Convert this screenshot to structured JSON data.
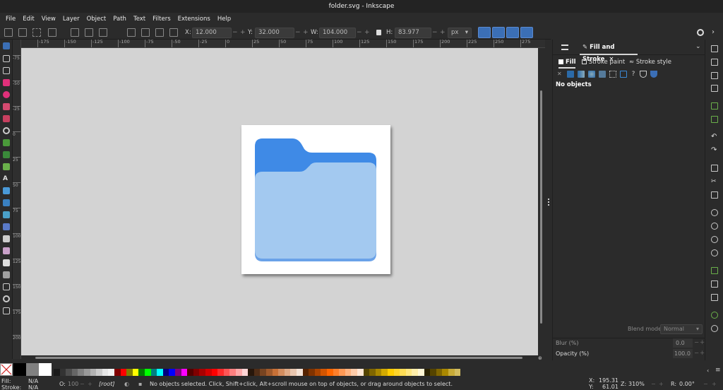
{
  "window": {
    "title": "folder.svg - Inkscape"
  },
  "menu": [
    "File",
    "Edit",
    "View",
    "Layer",
    "Object",
    "Path",
    "Text",
    "Filters",
    "Extensions",
    "Help"
  ],
  "toolbar": {
    "x_label": "X:",
    "x_value": "12.000",
    "y_label": "Y:",
    "y_value": "32.000",
    "w_label": "W:",
    "w_value": "104.000",
    "h_label": "H:",
    "h_value": "83.977",
    "unit": "px",
    "minus": "−",
    "plus": "+"
  },
  "hruler": [
    "-175",
    "-150",
    "-125",
    "-100",
    "-75",
    "-50",
    "-25",
    "0",
    "25",
    "50",
    "75",
    "100",
    "125",
    "150",
    "175",
    "200",
    "225",
    "250",
    "275"
  ],
  "vruler": [
    "-75",
    "-50",
    "-25",
    "0",
    "25",
    "50",
    "75",
    "100",
    "125",
    "150",
    "175",
    "200"
  ],
  "panel": {
    "tab_label": "Fill and Stroke",
    "tab_close": "×",
    "subtab_fill": "Fill",
    "subtab_stroke_paint": "Stroke paint",
    "subtab_stroke_style": "Stroke style",
    "message": "No objects",
    "blend_label": "Blend mode:",
    "blend_value": "Normal",
    "blur_label": "Blur (%)",
    "blur_value": "0.0",
    "opacity_label": "Opacity (%)",
    "opacity_value": "100.0",
    "unknown_glyph": "?"
  },
  "status": {
    "fill_label": "Fill:",
    "fill_value": "N/A",
    "stroke_label": "Stroke:",
    "stroke_value": "N/A",
    "o_label": "O:",
    "o_value": "100",
    "layer": "[root]",
    "message": "No objects selected. Click, Shift+click, Alt+scroll mouse on top of objects, or drag around objects to select.",
    "x_label": "X:",
    "x_value": "195.31",
    "y_label": "Y:",
    "y_value": "61.01",
    "z_label": "Z:",
    "zoom": "310%",
    "r_label": "R:",
    "rotation": "0.00°"
  },
  "colors": {
    "folder_back": "#3f8ae6",
    "folder_front": "#a3c9f0",
    "folder_bottom": "#6aa2e8",
    "canvas": "#d3d3d3",
    "accent": "#3b6fb6"
  },
  "icons": [
    "select-tool-icon",
    "node-tool-icon",
    "zoom-icon",
    "rectangle-icon",
    "ellipse-icon",
    "star-icon",
    "pen-icon",
    "pencil-icon",
    "calligraphy-icon",
    "text-icon",
    "gradient-icon",
    "mesh-icon",
    "dropper-icon",
    "bucket-icon",
    "spray-icon",
    "eraser-icon",
    "connector-icon",
    "measure-icon",
    "pages-icon"
  ]
}
